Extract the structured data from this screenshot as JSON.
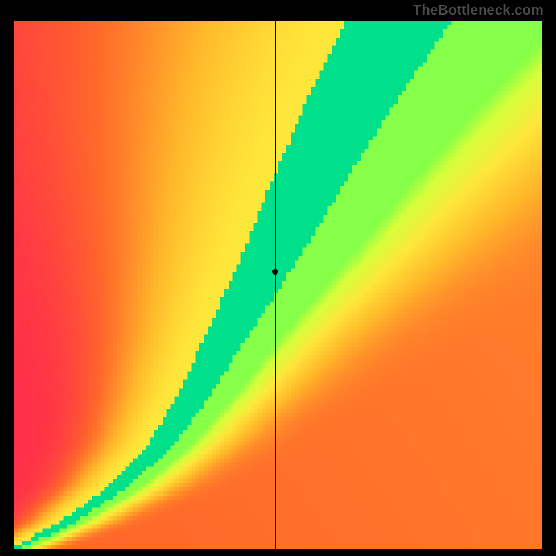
{
  "watermark": "TheBottleneck.com",
  "chart_data": {
    "type": "heatmap",
    "title": "",
    "xlabel": "",
    "ylabel": "",
    "x_range": [
      0,
      1
    ],
    "y_range": [
      0,
      1
    ],
    "grid": false,
    "crosshair": {
      "x": 0.495,
      "y": 0.525
    },
    "marker": {
      "x": 0.495,
      "y": 0.525
    },
    "color_scale": {
      "stops": [
        {
          "t": 0.0,
          "color": "#ff2a4d"
        },
        {
          "t": 0.25,
          "color": "#ff6a2a"
        },
        {
          "t": 0.5,
          "color": "#ffb82a"
        },
        {
          "t": 0.7,
          "color": "#ffe63a"
        },
        {
          "t": 0.85,
          "color": "#d6ff3a"
        },
        {
          "t": 0.93,
          "color": "#7bff4a"
        },
        {
          "t": 1.0,
          "color": "#00e08a"
        }
      ]
    },
    "ridge": {
      "control_points": [
        {
          "x": 0.0,
          "y": 0.0
        },
        {
          "x": 0.1,
          "y": 0.05
        },
        {
          "x": 0.2,
          "y": 0.12
        },
        {
          "x": 0.28,
          "y": 0.2
        },
        {
          "x": 0.34,
          "y": 0.29
        },
        {
          "x": 0.39,
          "y": 0.38
        },
        {
          "x": 0.44,
          "y": 0.47
        },
        {
          "x": 0.495,
          "y": 0.57
        },
        {
          "x": 0.56,
          "y": 0.7
        },
        {
          "x": 0.64,
          "y": 0.85
        },
        {
          "x": 0.73,
          "y": 1.0
        }
      ],
      "band_width_at_y": [
        {
          "y": 0.0,
          "w": 0.01
        },
        {
          "y": 0.1,
          "w": 0.018
        },
        {
          "y": 0.25,
          "w": 0.028
        },
        {
          "y": 0.4,
          "w": 0.04
        },
        {
          "y": 0.55,
          "w": 0.055
        },
        {
          "y": 0.7,
          "w": 0.07
        },
        {
          "y": 0.85,
          "w": 0.085
        },
        {
          "y": 1.0,
          "w": 0.1
        }
      ],
      "glow_scale": 3.2,
      "off_ridge_bias_right": 0.55
    },
    "resolution": 128
  }
}
